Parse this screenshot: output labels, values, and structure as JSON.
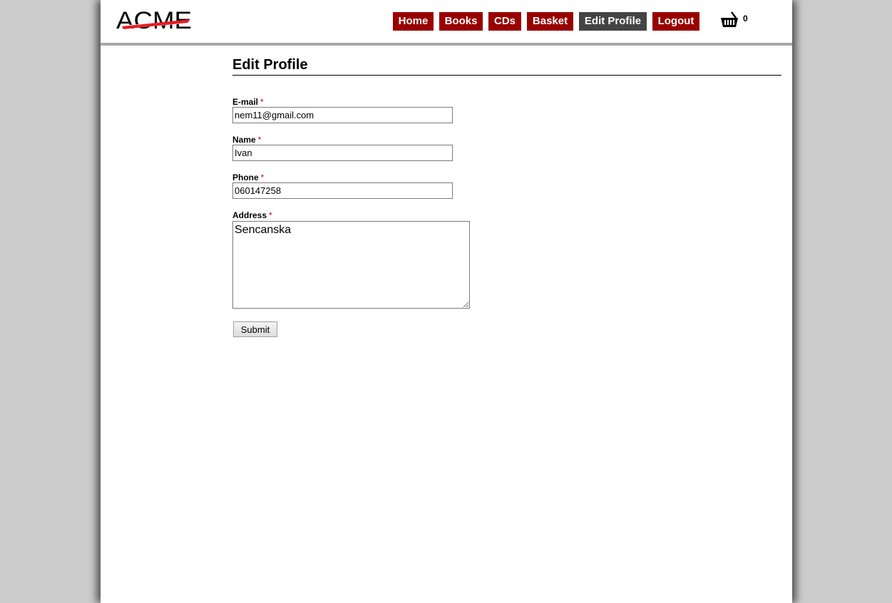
{
  "header": {
    "logo_text": "ACME",
    "nav": [
      {
        "label": "Home",
        "active": false
      },
      {
        "label": "Books",
        "active": false
      },
      {
        "label": "CDs",
        "active": false
      },
      {
        "label": "Basket",
        "active": false
      },
      {
        "label": "Edit Profile",
        "active": true
      },
      {
        "label": "Logout",
        "active": false
      }
    ],
    "cart": {
      "icon": "basket-icon",
      "count": "0"
    }
  },
  "form": {
    "title": "Edit Profile",
    "required_marker": "*",
    "email": {
      "label": "E-mail",
      "value": "nem11@gmail.com"
    },
    "name": {
      "label": "Name",
      "value": "Ivan"
    },
    "phone": {
      "label": "Phone",
      "value": "060147258"
    },
    "address": {
      "label": "Address",
      "value": "Sencanska"
    },
    "submit_label": "Submit"
  },
  "colors": {
    "nav_bg": "#990000",
    "nav_active_bg": "#444444",
    "required": "#cc0000",
    "logo_swoosh": "#e31e24"
  }
}
